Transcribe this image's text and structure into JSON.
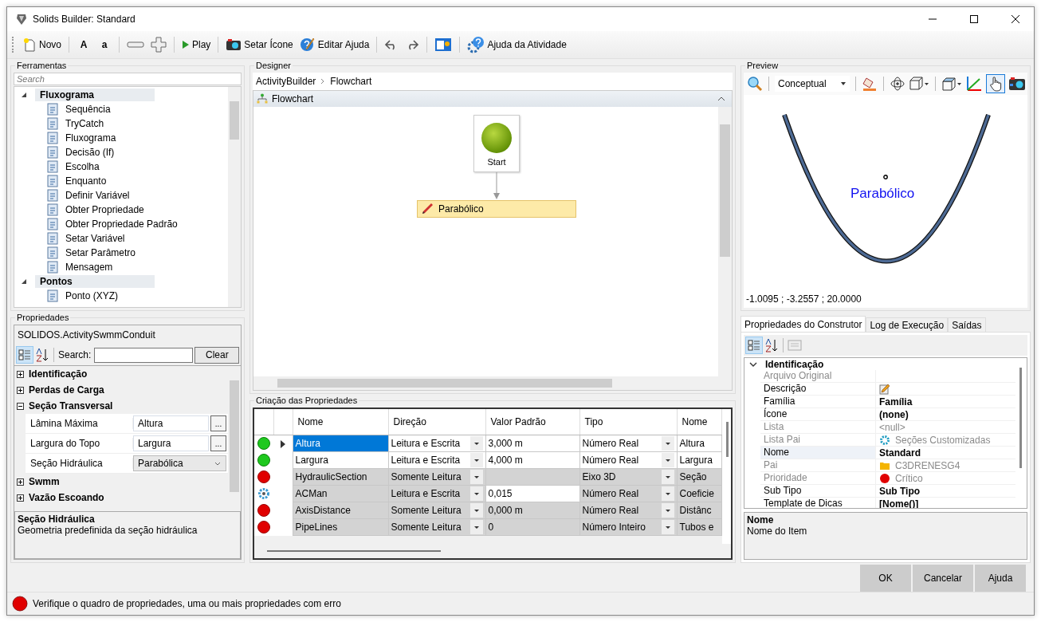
{
  "window": {
    "title": "Solids Builder: Standard"
  },
  "toolbar": {
    "new": "Novo",
    "font_larger": "A",
    "font_smaller": "a",
    "play": "Play",
    "set_icon": "Setar Ícone",
    "edit_help": "Editar Ajuda",
    "activity_help": "Ajuda da Atividade"
  },
  "tools": {
    "title": "Ferramentas",
    "search_placeholder": "Search",
    "groups": [
      {
        "label": "Fluxograma",
        "expanded": true,
        "children": [
          "Sequência",
          "TryCatch",
          "Fluxograma",
          "Decisão (If)",
          "Escolha",
          "Enquanto",
          "Definir Variável",
          "Obter Propriedade",
          "Obter Propriedade Padrão",
          "Setar Variável",
          "Setar Parâmetro",
          "Mensagem"
        ]
      },
      {
        "label": "Pontos",
        "expanded": true,
        "children": [
          "Ponto (XYZ)"
        ]
      }
    ]
  },
  "properties": {
    "title": "Propriedades",
    "object": "SOLIDOS.ActivitySwmmConduit",
    "search_label": "Search:",
    "clear": "Clear",
    "categories": [
      {
        "label": "Identificação",
        "expanded": false
      },
      {
        "label": "Perdas de Carga",
        "expanded": false
      },
      {
        "label": "Seção Transversal",
        "expanded": true,
        "rows": [
          {
            "name": "Lâmina Máxima",
            "value": "Altura",
            "kind": "ellipsis",
            "button": "..."
          },
          {
            "name": "Largura do Topo",
            "value": "Largura",
            "kind": "ellipsis",
            "button": "..."
          },
          {
            "name": "Seção Hidráulica",
            "value": "Parabólica",
            "kind": "dropdown"
          }
        ]
      },
      {
        "label": "Swmm",
        "expanded": false
      },
      {
        "label": "Vazão Escoando",
        "expanded": false
      }
    ],
    "help_title": "Seção Hidráulica",
    "help_text": "Geometria predefinida da seção hidráulica"
  },
  "designer": {
    "title": "Designer",
    "breadcrumb": [
      "ActivityBuilder",
      "Flowchart"
    ],
    "canvas_title": "Flowchart",
    "start_label": "Start",
    "activity_label": "Parabólico"
  },
  "property_creation": {
    "title": "Criação das Propriedades",
    "columns": [
      "Nome",
      "Direção",
      "Valor Padrão",
      "Tipo",
      "Nome"
    ],
    "rows": [
      {
        "kind": "ok",
        "selected": true,
        "readonly": false,
        "name": "Altura",
        "direction": "Leitura e Escrita",
        "default": "3,000 m",
        "type": "Número Real",
        "column_5": "Altura"
      },
      {
        "kind": "ok",
        "selected": false,
        "readonly": false,
        "name": "Largura",
        "direction": "Leitura e Escrita",
        "default": "4,000 m",
        "type": "Número Real",
        "column_5": "Largura"
      },
      {
        "kind": "error",
        "selected": false,
        "readonly": true,
        "value_editable": false,
        "name": "HydraulicSection",
        "direction": "Somente Leitura",
        "type": "Eixo 3D",
        "column_5": "Seção"
      },
      {
        "kind": "computed",
        "selected": false,
        "readonly": true,
        "value_editable": true,
        "name": "ACMan",
        "direction": "Leitura e Escrita",
        "default": "0,015",
        "type": "Número Real",
        "column_5": "Coeficie"
      },
      {
        "kind": "error",
        "selected": false,
        "readonly": true,
        "value_editable": false,
        "name": "AxisDistance",
        "direction": "Somente Leitura",
        "default": "0,000 m",
        "type": "Número Real",
        "column_5": "Distânc"
      },
      {
        "kind": "error",
        "selected": false,
        "readonly": true,
        "value_editable": false,
        "name": "PipeLines",
        "direction": "Somente Leitura",
        "default": "0",
        "type": "Número Inteiro",
        "column_5": "Tubos e"
      }
    ]
  },
  "preview": {
    "title": "Preview",
    "view_style": "Conceptual",
    "pan_active": true,
    "label": "Parabólico",
    "coordinates": "-1.0095 ; -3.2557 ; 20.0000"
  },
  "builder": {
    "tabs": [
      {
        "label": "Propriedades do Construtor",
        "selected": true
      },
      {
        "label": "Log de Execução",
        "selected": false
      },
      {
        "label": "Saídas",
        "selected": false
      }
    ],
    "category": "Identificação",
    "category_expanded": true,
    "rows": [
      {
        "kind": "text",
        "name": "Arquivo Original",
        "disabled": true,
        "selected": false
      },
      {
        "kind": "editor",
        "name": "Descrição",
        "disabled": false,
        "selected": false
      },
      {
        "kind": "text",
        "name": "Família",
        "value": "Família",
        "disabled": false,
        "modified": true,
        "selected": false
      },
      {
        "kind": "text",
        "name": "Ícone",
        "value": "(none)",
        "disabled": false,
        "modified": true,
        "selected": false
      },
      {
        "kind": "text",
        "name": "Lista",
        "value": "<null>",
        "disabled": true,
        "modified": false,
        "selected": false
      },
      {
        "kind": "list",
        "name": "Lista Pai",
        "value": "Seções Customizadas",
        "disabled": true,
        "modified": false,
        "selected": false
      },
      {
        "kind": "text",
        "name": "Nome",
        "value": "Standard",
        "disabled": false,
        "modified": true,
        "selected": true
      },
      {
        "kind": "folder",
        "name": "Pai",
        "value": "C3DRENESG4",
        "disabled": true,
        "modified": false,
        "selected": false
      },
      {
        "kind": "priority",
        "name": "Prioridade",
        "value": "Crítico",
        "disabled": true,
        "modified": false,
        "selected": false
      },
      {
        "kind": "text",
        "name": "Sub Tipo",
        "value": "Sub Tipo",
        "disabled": false,
        "modified": true,
        "selected": false
      },
      {
        "kind": "text",
        "name": "Template de Dicas",
        "value": "[Nome()]",
        "disabled": false,
        "modified": true,
        "selected": false
      }
    ],
    "help_title": "Nome",
    "help_text": "Nome do Item"
  },
  "buttons": [
    "OK",
    "Cancelar",
    "Ajuda"
  ],
  "status_bar": {
    "kind": "error",
    "message": "Verifique o quadro de propriedades, uma ou mais propriedades com erro"
  }
}
